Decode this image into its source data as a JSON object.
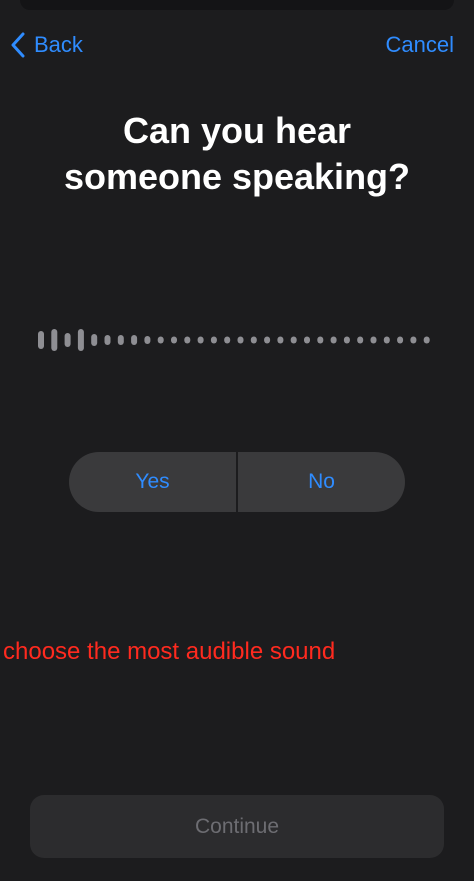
{
  "nav": {
    "back_label": "Back",
    "cancel_label": "Cancel"
  },
  "title_line1": "Can you hear",
  "title_line2": "someone speaking?",
  "options": {
    "yes_label": "Yes",
    "no_label": "No"
  },
  "hint": "choose the most audible sound",
  "continue_label": "Continue",
  "colors": {
    "background": "#1c1c1e",
    "accent": "#2f8cff",
    "hint": "#ff2a1f",
    "disabled_text": "#6d6d72"
  }
}
